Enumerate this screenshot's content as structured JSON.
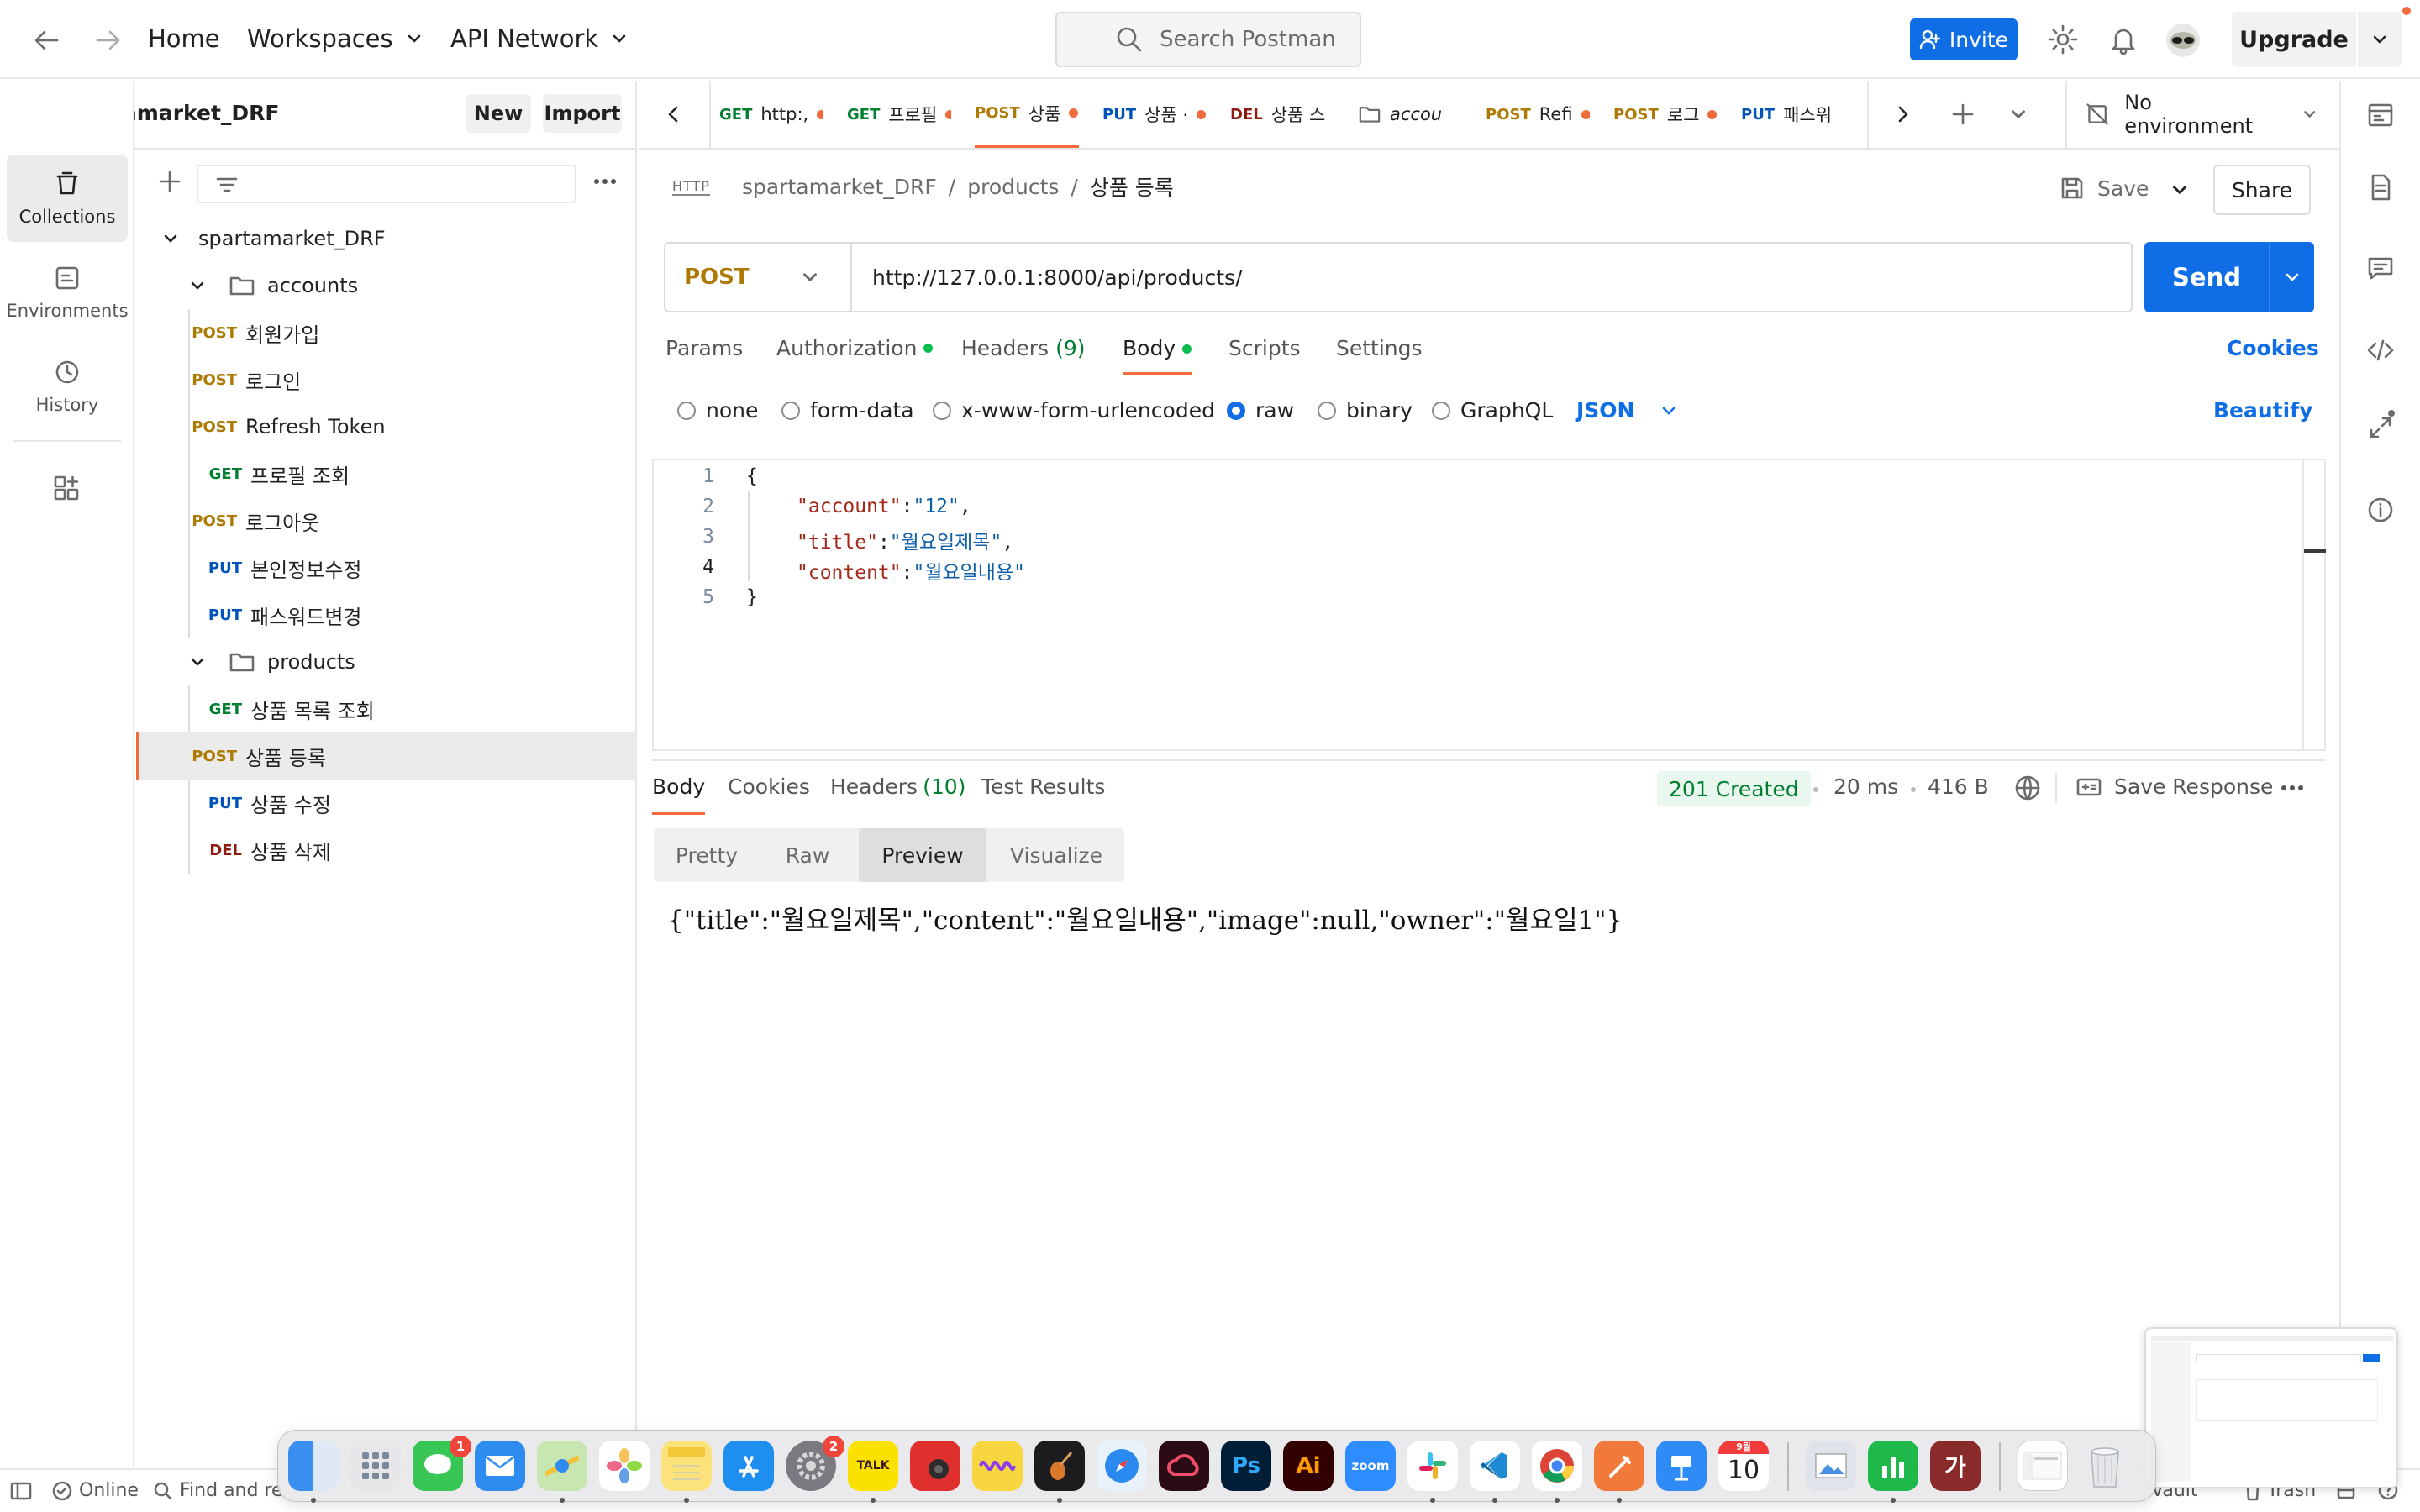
{
  "topbar": {
    "home": "Home",
    "workspaces": "Workspaces",
    "api_network": "API Network",
    "search_placeholder": "Search Postman",
    "invite": "Invite",
    "upgrade": "Upgrade"
  },
  "rail": {
    "items": [
      {
        "label": "Collections",
        "icon": "collections-icon"
      },
      {
        "label": "Environments",
        "icon": "environments-icon"
      },
      {
        "label": "History",
        "icon": "history-icon"
      }
    ]
  },
  "sidebar": {
    "workspace_name": "spartamarket_DRF",
    "new_label": "New",
    "import_label": "Import",
    "collection": "spartamarket_DRF",
    "folders": [
      {
        "name": "accounts",
        "requests": [
          {
            "method": "POST",
            "name": "회원가입"
          },
          {
            "method": "POST",
            "name": "로그인"
          },
          {
            "method": "POST",
            "name": "Refresh Token"
          },
          {
            "method": "GET",
            "name": "프로필 조회"
          },
          {
            "method": "POST",
            "name": "로그아웃"
          },
          {
            "method": "PUT",
            "name": "본인정보수정"
          },
          {
            "method": "PUT",
            "name": "패스워드변경"
          }
        ]
      },
      {
        "name": "products",
        "requests": [
          {
            "method": "GET",
            "name": "상품 목록 조회"
          },
          {
            "method": "POST",
            "name": "상품 등록"
          },
          {
            "method": "PUT",
            "name": "상품 수정"
          },
          {
            "method": "DEL",
            "name": "상품 삭제"
          }
        ]
      }
    ]
  },
  "tabs": [
    {
      "method": "GET",
      "name": "http:,"
    },
    {
      "method": "GET",
      "name": "프로필"
    },
    {
      "method": "POST",
      "name": "상품"
    },
    {
      "method": "PUT",
      "name": "상품 ·"
    },
    {
      "method": "DEL",
      "name": "상품 스"
    },
    {
      "method": "",
      "name": "accou"
    },
    {
      "method": "POST",
      "name": "Refi"
    },
    {
      "method": "POST",
      "name": "로그"
    },
    {
      "method": "PUT",
      "name": "패스워"
    }
  ],
  "environment": "No environment",
  "request": {
    "breadcrumb": [
      "spartamarket_DRF",
      "products",
      "상품 등록"
    ],
    "http_badge": "HTTP",
    "save": "Save",
    "share": "Share",
    "method": "POST",
    "url": "http://127.0.0.1:8000/api/products/",
    "send": "Send",
    "tabs": {
      "params": "Params",
      "authorization": "Authorization",
      "headers": "Headers",
      "headers_count": "(9)",
      "body": "Body",
      "scripts": "Scripts",
      "settings": "Settings",
      "cookies": "Cookies"
    },
    "body_types": [
      "none",
      "form-data",
      "x-www-form-urlencoded",
      "raw",
      "binary",
      "GraphQL"
    ],
    "format": "JSON",
    "beautify": "Beautify",
    "line_numbers": [
      "1",
      "2",
      "3",
      "4",
      "5"
    ],
    "code": {
      "open": "{",
      "k1": "\"account\"",
      "v1": "\"12\"",
      "k2": "\"title\"",
      "v2": "\"월요일제목\"",
      "k3": "\"content\"",
      "v3": "\"월요일내용\"",
      "close": "}"
    }
  },
  "response": {
    "tabs": {
      "body": "Body",
      "cookies": "Cookies",
      "headers": "Headers",
      "headers_count": "(10)",
      "tests": "Test Results"
    },
    "status": "201 Created",
    "time": "20 ms",
    "size": "416 B",
    "save_response": "Save Response",
    "views": [
      "Pretty",
      "Raw",
      "Preview",
      "Visualize"
    ],
    "preview_text": "{\"title\":\"월요일제목\",\"content\":\"월요일내용\",\"image\":null,\"owner\":\"월요일1\"}"
  },
  "statusbar": {
    "online": "Online",
    "find": "Find and re",
    "vault": "Vault",
    "trash": "Trash"
  },
  "dock": {
    "messages_badge": "1",
    "settings_badge": "2",
    "talk_label": "TALK",
    "ps_label": "Ps",
    "ai_label": "Ai",
    "zoom_label": "zoom",
    "calendar_month": "9월",
    "calendar_day": "10",
    "dict_label": "가"
  },
  "colors": {
    "accent": "#0f6ee6",
    "post": "#ad7a03",
    "get": "#007f31",
    "put": "#0053b8",
    "del": "#8e1a10",
    "active_tab": "#f26b3a"
  }
}
